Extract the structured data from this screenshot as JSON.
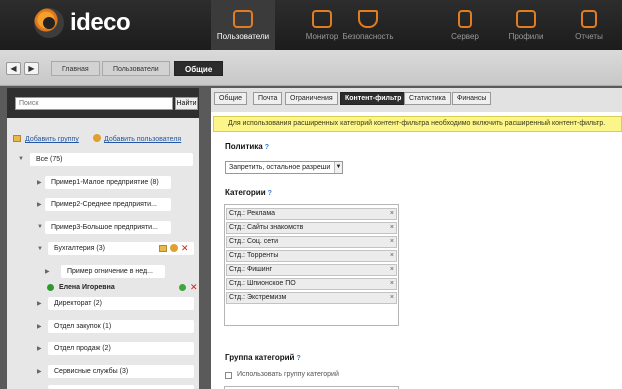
{
  "brand": {
    "name": "ideco"
  },
  "nav": [
    {
      "label": "Пользователи",
      "icon": "users-icon",
      "active": true
    },
    {
      "label": "Монитор",
      "icon": "monitor-icon"
    },
    {
      "label": "Безопасность",
      "icon": "shield-icon"
    },
    {
      "label": "Сервер",
      "icon": "server-icon"
    },
    {
      "label": "Профили",
      "icon": "profiles-icon"
    },
    {
      "label": "Отчеты",
      "icon": "reports-icon"
    }
  ],
  "breadcrumbs": [
    "Главная",
    "Пользователи",
    "Общие"
  ],
  "search": {
    "placeholder": "Поиск",
    "button": "Найти"
  },
  "actions": {
    "add_group": "Добавить группу",
    "add_user": "Добавить пользователя"
  },
  "tree": [
    {
      "label": "Все (75)"
    },
    {
      "label": "Пример1-Малое предприятие (8)"
    },
    {
      "label": "Пример2-Среднее предприяти..."
    },
    {
      "label": "Пример3-Большое предприяти..."
    },
    {
      "label": "Бухгалтерия (3)"
    },
    {
      "label": "Пример огничение в нед..."
    },
    {
      "label": "Елена Игоревна"
    },
    {
      "label": "Директорат (2)"
    },
    {
      "label": "Отдел закупок (1)"
    },
    {
      "label": "Отдел продаж (2)"
    },
    {
      "label": "Сервисные службы (3)"
    }
  ],
  "tabs": [
    "Общие",
    "Почта",
    "Ограничения",
    "Контент-фильтр",
    "Статистика",
    "Финансы"
  ],
  "notice": "Для использования расширенных категорий контент-фильтра необходимо включить расширенный контент-фильтр.",
  "policy": {
    "title": "Политика",
    "help": "?",
    "value": "Запретить, остальное разреши"
  },
  "categories": {
    "title": "Категории",
    "help": "?",
    "items": [
      "Стд.: Реклама",
      "Стд.: Сайты знакомств",
      "Стд.: Соц. сети",
      "Стд.: Торренты",
      "Стд.: Фишинг",
      "Стд.: Шпионское ПО",
      "Стд.: Экстремизм"
    ],
    "remove_glyph": "×"
  },
  "category_group": {
    "title": "Группа категорий",
    "help": "?",
    "checkbox_label": "Использовать группу категорий"
  },
  "colors": {
    "accent": "#e07c22",
    "link": "#2456a4",
    "notice_bg": "#fbf58a"
  }
}
